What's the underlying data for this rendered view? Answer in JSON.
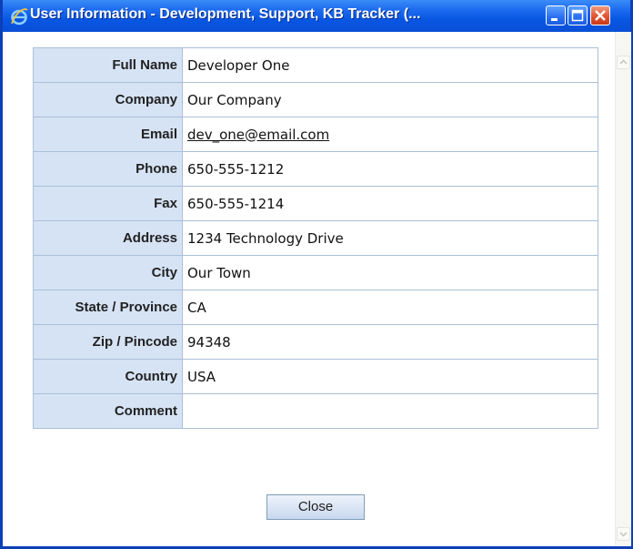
{
  "window": {
    "title": "User Information - Development, Support, KB Tracker (...",
    "icon": "internet-explorer-icon"
  },
  "colors": {
    "titlebar": "#0a4fd6",
    "label_bg": "#d6e3f5",
    "border": "#a9bfd9"
  },
  "rows": [
    {
      "label": "Full Name",
      "value": "Developer One"
    },
    {
      "label": "Company",
      "value": "Our Company"
    },
    {
      "label": "Email",
      "value": "dev_one@email.com"
    },
    {
      "label": "Phone",
      "value": "650-555-1212"
    },
    {
      "label": "Fax",
      "value": "650-555-1214"
    },
    {
      "label": "Address",
      "value": "1234 Technology Drive"
    },
    {
      "label": "City",
      "value": "Our Town"
    },
    {
      "label": "State / Province",
      "value": "CA"
    },
    {
      "label": "Zip / Pincode",
      "value": "94348"
    },
    {
      "label": "Country",
      "value": "USA"
    },
    {
      "label": "Comment",
      "value": ""
    }
  ],
  "actions": {
    "close_label": "Close"
  }
}
